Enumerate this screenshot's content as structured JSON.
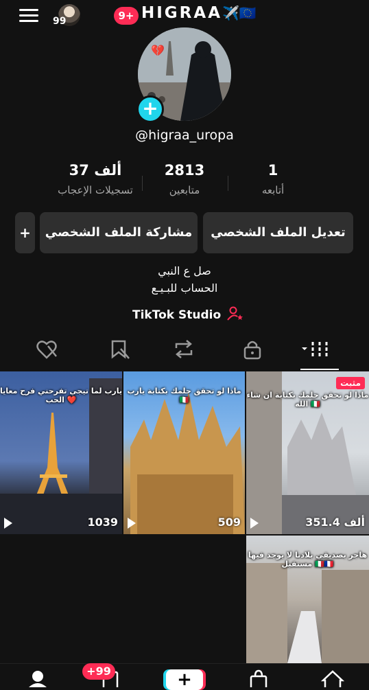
{
  "header": {
    "menu_icon": "hamburger-icon",
    "avatar_badge": "99",
    "notification_badge": "9+",
    "brand_title": "HIGRAA",
    "brand_emoji": "✈️🇪🇺"
  },
  "profile": {
    "username": "@higraa_uropa",
    "add_icon": "plus-icon",
    "heart_emoji": "💔"
  },
  "stats": [
    {
      "value": "37 ألف",
      "label": "تسجيلات الإعجاب"
    },
    {
      "value": "2813",
      "label": "متابعين"
    },
    {
      "value": "1",
      "label": "أتابعه"
    }
  ],
  "buttons": {
    "share": "مشاركة الملف الشخصي",
    "edit": "تعديل الملف الشخصي",
    "add_friend_icon": "add-user-icon"
  },
  "bio": {
    "line1": "صل ع النبي",
    "line2": "الحساب للبـيـع"
  },
  "studio": {
    "label": "TikTok Studio",
    "icon": "person-star-icon"
  },
  "tabs": [
    {
      "name": "liked",
      "icon": "heart-slash-icon"
    },
    {
      "name": "favorites",
      "icon": "bookmark-icon"
    },
    {
      "name": "reposts",
      "icon": "repost-icon"
    },
    {
      "name": "private",
      "icon": "lock-icon"
    },
    {
      "name": "videos",
      "icon": "grid-icon"
    }
  ],
  "videos": [
    {
      "caption": "يارب لما تيجي تفرحني فرح معايا الحب ❤️",
      "views": "1039"
    },
    {
      "caption": "ماذا لو تحقق حلمك بكتابة يارب 🇮🇹",
      "views": "509"
    },
    {
      "caption": "ماذا لو تحقق حلمك بكتابة ان شاء الله 🇮🇹",
      "views": "351.4 ألف",
      "pinned": "مثبت"
    },
    {
      "caption": "هاجر بصديقي بلادنا لا يوجد فيها مستقبل 🇮🇹🇫🇷",
      "views": ""
    }
  ],
  "bottom_nav": {
    "inbox_badge": "+99",
    "items": [
      "profile-icon",
      "inbox-icon",
      "create-icon",
      "shop-icon",
      "home-icon"
    ]
  }
}
